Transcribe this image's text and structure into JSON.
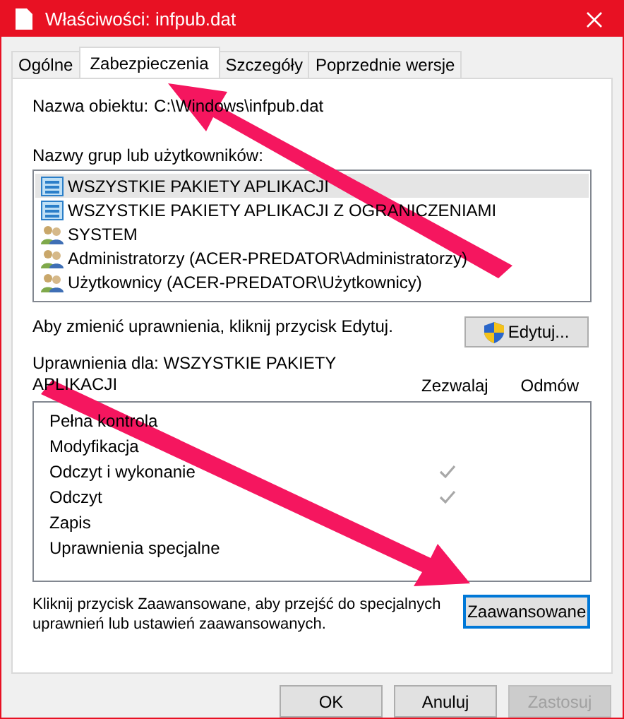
{
  "window": {
    "title": "Właściwości: infpub.dat"
  },
  "tabs": [
    {
      "label": "Ogólne",
      "selected": false
    },
    {
      "label": "Zabezpieczenia",
      "selected": true
    },
    {
      "label": "Szczegóły",
      "selected": false
    },
    {
      "label": "Poprzednie wersje",
      "selected": false
    }
  ],
  "object_name": {
    "label": "Nazwa obiektu:",
    "value": "C:\\Windows\\infpub.dat"
  },
  "groups": {
    "label": "Nazwy grup lub użytkowników:",
    "items": [
      {
        "name": "WSZYSTKIE PAKIETY APLIKACJI",
        "kind": "package",
        "selected": true
      },
      {
        "name": "WSZYSTKIE PAKIETY APLIKACJI Z OGRANICZENIAMI",
        "kind": "package",
        "selected": false
      },
      {
        "name": "SYSTEM",
        "kind": "users",
        "selected": false
      },
      {
        "name": "Administratorzy (ACER-PREDATOR\\Administratorzy)",
        "kind": "users",
        "selected": false
      },
      {
        "name": "Użytkownicy (ACER-PREDATOR\\Użytkownicy)",
        "kind": "users",
        "selected": false
      }
    ]
  },
  "edit_hint": "Aby zmienić uprawnienia, kliknij przycisk Edytuj.",
  "edit_button": "Edytuj...",
  "permissions": {
    "title": "Uprawnienia dla: WSZYSTKIE PAKIETY APLIKACJI",
    "allow_header": "Zezwalaj",
    "deny_header": "Odmów",
    "rows": [
      {
        "name": "Pełna kontrola",
        "allow": false,
        "deny": false
      },
      {
        "name": "Modyfikacja",
        "allow": false,
        "deny": false
      },
      {
        "name": "Odczyt i wykonanie",
        "allow": true,
        "deny": false
      },
      {
        "name": "Odczyt",
        "allow": true,
        "deny": false
      },
      {
        "name": "Zapis",
        "allow": false,
        "deny": false
      },
      {
        "name": "Uprawnienia specjalne",
        "allow": false,
        "deny": false
      }
    ]
  },
  "advanced_hint": "Kliknij przycisk Zaawansowane, aby przejść do specjalnych uprawnień lub ustawień zaawansowanych.",
  "advanced_button": "Zaawansowane",
  "buttons": [
    {
      "label": "OK",
      "disabled": false
    },
    {
      "label": "Anuluj",
      "disabled": false
    },
    {
      "label": "Zastosuj",
      "disabled": true
    }
  ]
}
